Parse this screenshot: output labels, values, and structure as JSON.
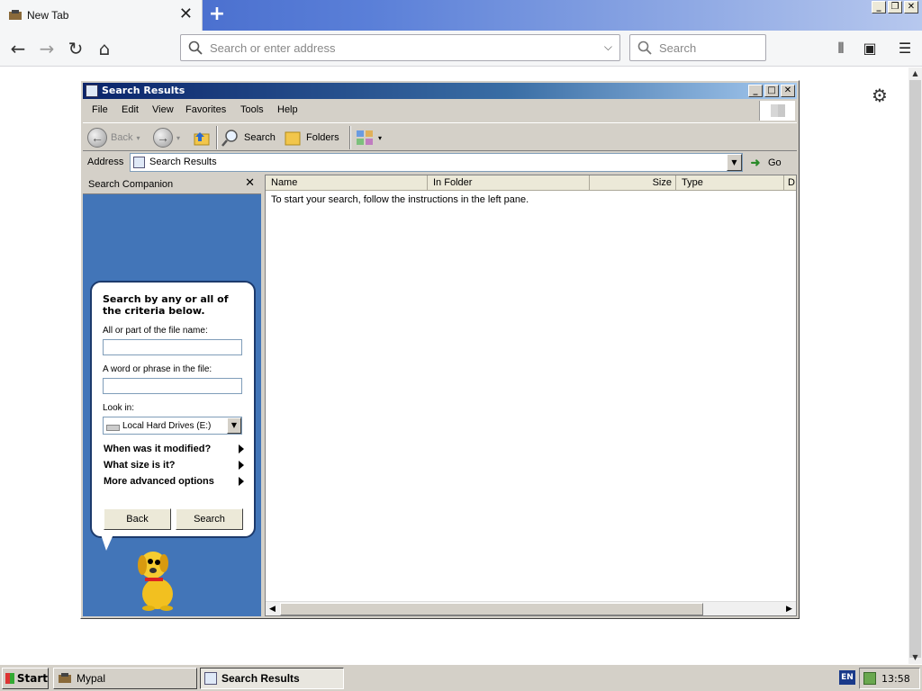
{
  "browser": {
    "tab_title": "New Tab",
    "urlbar_placeholder": "Search or enter address",
    "searchbar_placeholder": "Search"
  },
  "window": {
    "title": "Search Results",
    "menu": [
      "File",
      "Edit",
      "View",
      "Favorites",
      "Tools",
      "Help"
    ],
    "toolbar": {
      "back_label": "Back",
      "search_label": "Search",
      "folders_label": "Folders"
    },
    "address": {
      "label": "Address",
      "value": "Search Results",
      "go_label": "Go"
    }
  },
  "companion": {
    "title": "Search Companion",
    "heading": "Search by any or all of the criteria below.",
    "filename_label": "All or part of the file name:",
    "phrase_label": "A word or phrase in the file:",
    "lookin_label": "Look in:",
    "lookin_value": "Local Hard Drives (E:)",
    "options": [
      "When was it modified?",
      "What size is it?",
      "More advanced options"
    ],
    "back_button": "Back",
    "search_button": "Search"
  },
  "results": {
    "columns": [
      "Name",
      "In Folder",
      "Size",
      "Type",
      "D"
    ],
    "message": "To start your search, follow the instructions in the left pane."
  },
  "taskbar": {
    "start_label": "Start",
    "tasks": [
      "Mypal",
      "Search Results"
    ],
    "language": "EN",
    "clock": "13:58"
  }
}
